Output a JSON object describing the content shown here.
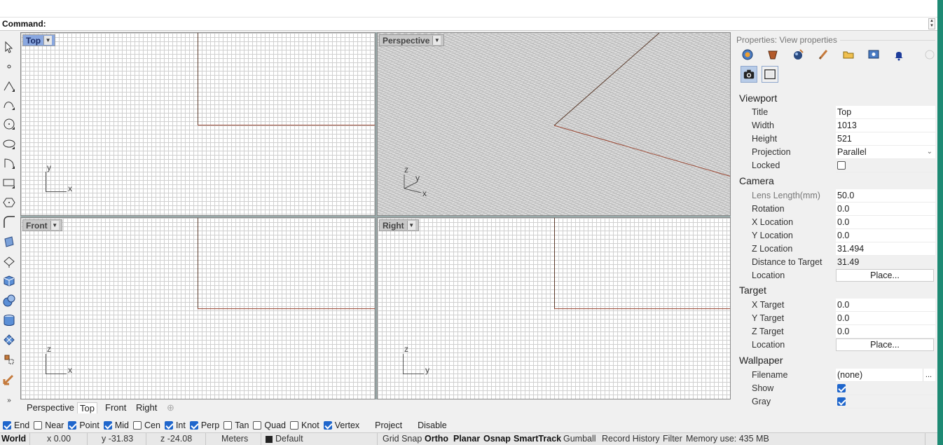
{
  "command": {
    "label": "Command:"
  },
  "viewports": {
    "top": {
      "label": "Top",
      "axes": [
        "y",
        "x"
      ]
    },
    "perspective": {
      "label": "Perspective",
      "axes": [
        "z",
        "y",
        "x"
      ]
    },
    "front": {
      "label": "Front",
      "axes": [
        "z",
        "x"
      ]
    },
    "right": {
      "label": "Right",
      "axes": [
        "z",
        "y"
      ]
    }
  },
  "viewport_tabs": [
    "Perspective",
    "Top",
    "Front",
    "Right"
  ],
  "osnaps": [
    {
      "label": "End",
      "checked": true
    },
    {
      "label": "Near",
      "checked": false
    },
    {
      "label": "Point",
      "checked": true
    },
    {
      "label": "Mid",
      "checked": true
    },
    {
      "label": "Cen",
      "checked": false
    },
    {
      "label": "Int",
      "checked": true
    },
    {
      "label": "Perp",
      "checked": true
    },
    {
      "label": "Tan",
      "checked": false
    },
    {
      "label": "Quad",
      "checked": false
    },
    {
      "label": "Knot",
      "checked": false
    },
    {
      "label": "Vertex",
      "checked": true
    },
    {
      "label": "Project",
      "checked": null
    },
    {
      "label": "Disable",
      "checked": null
    }
  ],
  "status": {
    "cplane": "World",
    "x": "x 0.00",
    "y": "y -31.83",
    "z": "z -24.08",
    "units": "Meters",
    "layer": "Default",
    "grid_snap": "Grid Snap",
    "ortho": "Ortho",
    "planar": "Planar",
    "osnap": "Osnap",
    "smarttrack": "SmartTrack",
    "gumball": "Gumball",
    "record_history": "Record History",
    "filter": "Filter",
    "memory": "Memory use: 435 MB"
  },
  "properties": {
    "title": "Properties: View properties",
    "sections": {
      "viewport": "Viewport",
      "camera": "Camera",
      "target": "Target",
      "wallpaper": "Wallpaper"
    },
    "viewport": {
      "title_label": "Title",
      "title_value": "Top",
      "width_label": "Width",
      "width_value": "1013",
      "height_label": "Height",
      "height_value": "521",
      "projection_label": "Projection",
      "projection_value": "Parallel",
      "locked_label": "Locked"
    },
    "camera": {
      "lens_label": "Lens Length(mm)",
      "lens_value": "50.0",
      "rotation_label": "Rotation",
      "rotation_value": "0.0",
      "xloc_label": "X Location",
      "xloc_value": "0.0",
      "yloc_label": "Y Location",
      "yloc_value": "0.0",
      "zloc_label": "Z Location",
      "zloc_value": "31.494",
      "dist_label": "Distance to Target",
      "dist_value": "31.49",
      "location_label": "Location",
      "place_label": "Place..."
    },
    "target": {
      "xt_label": "X Target",
      "xt_value": "0.0",
      "yt_label": "Y Target",
      "yt_value": "0.0",
      "zt_label": "Z Target",
      "zt_value": "0.0",
      "location_label": "Location",
      "place_label": "Place..."
    },
    "wallpaper": {
      "filename_label": "Filename",
      "filename_value": "(none)",
      "browse_label": "...",
      "show_label": "Show",
      "gray_label": "Gray"
    }
  },
  "colors": {
    "accent": "#1f66cc",
    "active_tab": "#8aa8e0",
    "window_frame": "#1e8a74",
    "curve": "#9b4a36"
  }
}
